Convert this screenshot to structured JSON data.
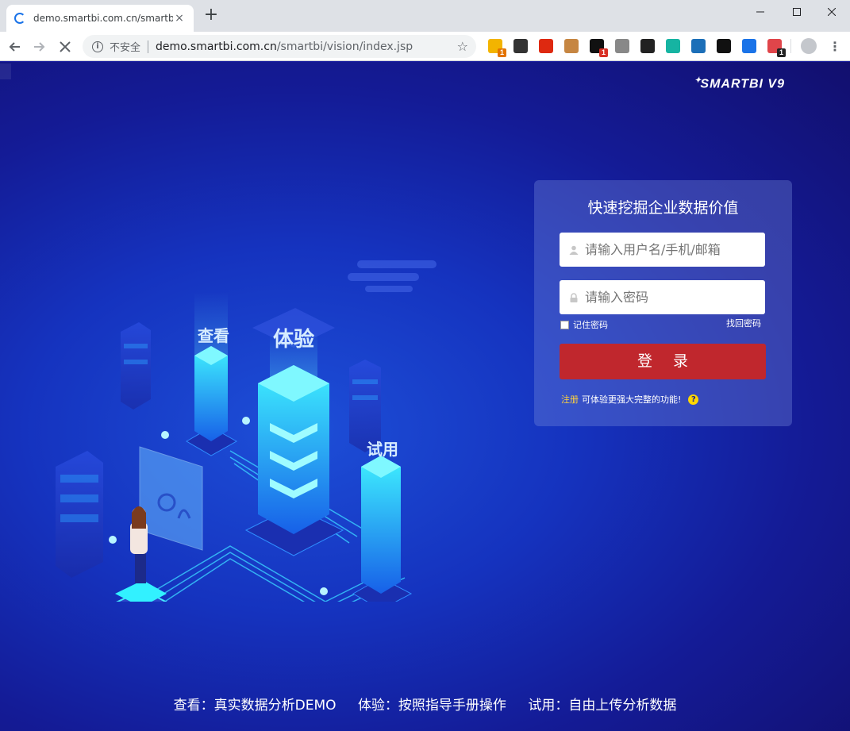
{
  "browser": {
    "tab_title": "demo.smartbi.com.cn/smartbi/",
    "tab_close": "×",
    "new_tab": "+",
    "insecure_label": "不安全",
    "url_host": "demo.smartbi.com.cn",
    "url_path": "/smartbi/vision/index.jsp",
    "extensions": [
      {
        "name": "ext-yellow",
        "color": "#f3b400",
        "badge": "1",
        "badge_color": "#e37400"
      },
      {
        "name": "ext-mask",
        "color": "#333333",
        "badge": "",
        "badge_color": ""
      },
      {
        "name": "ext-flag",
        "color": "#de2910",
        "badge": "",
        "badge_color": ""
      },
      {
        "name": "ext-cookie",
        "color": "#c68642",
        "badge": "",
        "badge_color": ""
      },
      {
        "name": "ext-black",
        "color": "#111111",
        "badge": "1",
        "badge_color": "#d93025"
      },
      {
        "name": "ext-ip",
        "color": "#888888",
        "badge": "",
        "badge_color": ""
      },
      {
        "name": "ext-ring",
        "color": "#222222",
        "badge": "",
        "badge_color": ""
      },
      {
        "name": "ext-teal",
        "color": "#16b4a2",
        "badge": "",
        "badge_color": ""
      },
      {
        "name": "ext-blue",
        "color": "#1c6fb8",
        "badge": "",
        "badge_color": ""
      },
      {
        "name": "ext-terminal",
        "color": "#111111",
        "badge": "",
        "badge_color": ""
      },
      {
        "name": "ext-pin",
        "color": "#1a73e8",
        "badge": "",
        "badge_color": ""
      },
      {
        "name": "ext-red",
        "color": "#e0454a",
        "badge": "1",
        "badge_color": "#222222"
      }
    ]
  },
  "page": {
    "brand": "SMARTBI  V9",
    "illustration_labels": {
      "view": "查看",
      "experience": "体验",
      "trial": "试用"
    },
    "login": {
      "headline": "快速挖掘企业数据价值",
      "username_placeholder": "请输入用户名/手机/邮箱",
      "password_placeholder": "请输入密码",
      "remember_label": "记住密码",
      "forgot_label": "找回密码",
      "login_button": "登录",
      "register_link": "注册",
      "register_text": "可体验更强大完整的功能!",
      "help_icon": "?"
    },
    "footer": [
      "查看：真实数据分析DEMO",
      "体验：按照指导手册操作",
      "试用：自由上传分析数据"
    ]
  },
  "colors": {
    "login_button": "#c0272d",
    "register_link": "#ffd33d",
    "page_bg": "#1533bf"
  }
}
